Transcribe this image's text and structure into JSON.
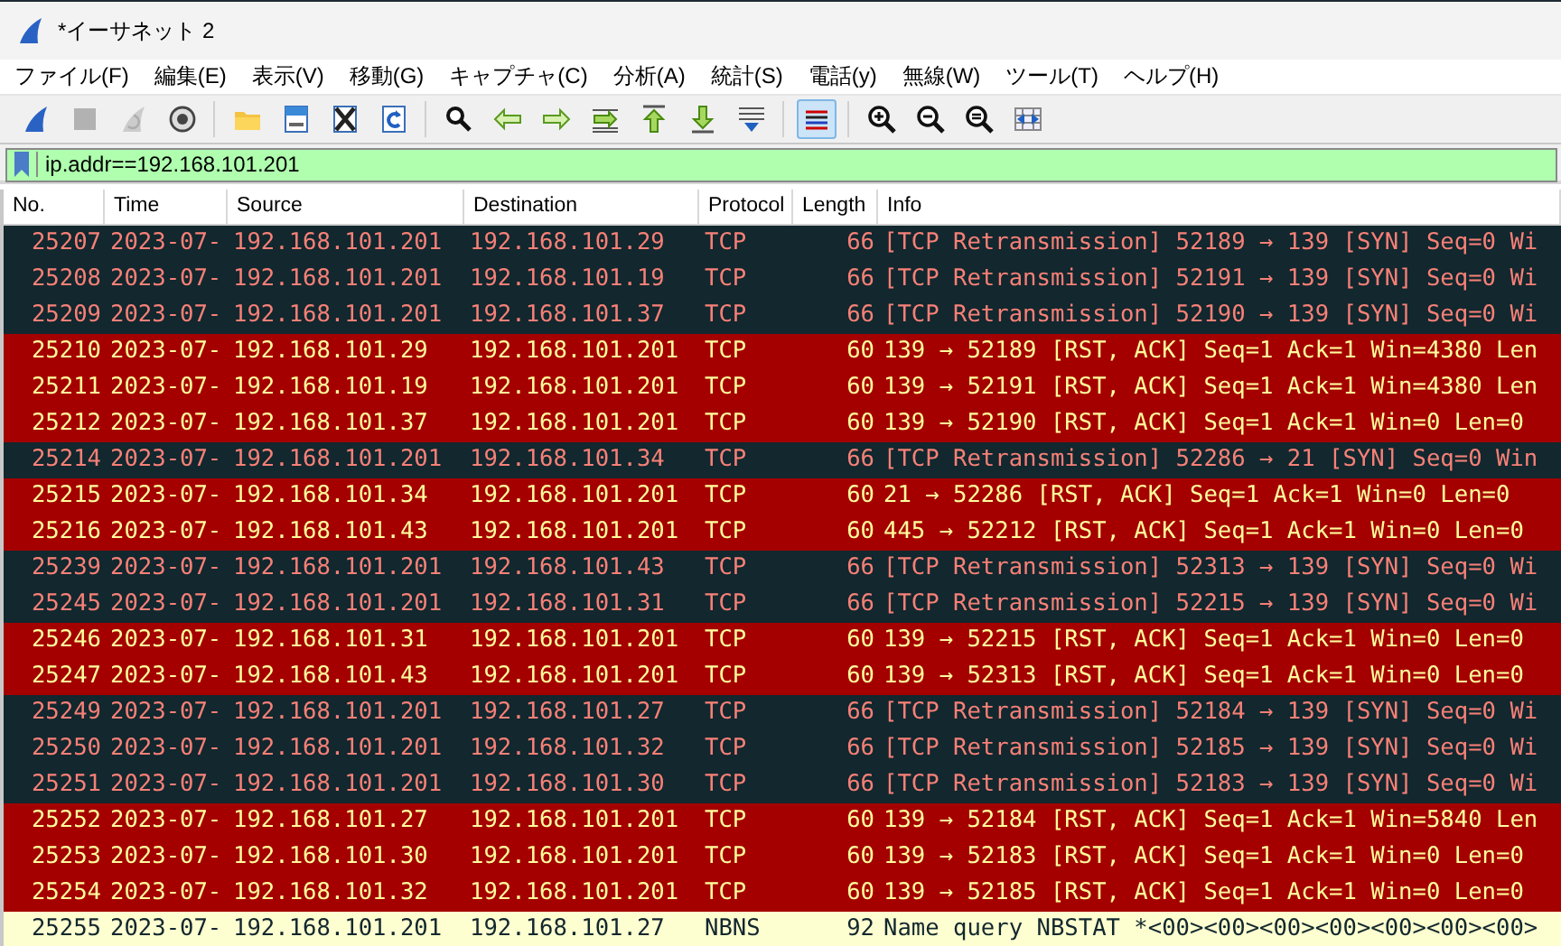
{
  "window": {
    "title": "*イーサネット 2"
  },
  "menu": [
    "ファイル(F)",
    "編集(E)",
    "表示(V)",
    "移動(G)",
    "キャプチャ(C)",
    "分析(A)",
    "統計(S)",
    "電話(y)",
    "無線(W)",
    "ツール(T)",
    "ヘルプ(H)"
  ],
  "toolbar": [
    [
      {
        "disabled": false,
        "selected": false
      },
      {
        "disabled": true,
        "selected": false
      },
      {
        "disabled": true,
        "selected": false
      },
      {
        "disabled": false,
        "selected": false
      }
    ],
    [
      {
        "disabled": false,
        "selected": false
      },
      {
        "disabled": false,
        "selected": false
      },
      {
        "disabled": false,
        "selected": false
      },
      {
        "disabled": false,
        "selected": false
      }
    ],
    [
      {
        "disabled": false,
        "selected": false
      },
      {
        "disabled": false,
        "selected": false
      },
      {
        "disabled": false,
        "selected": false
      },
      {
        "disabled": false,
        "selected": false
      },
      {
        "disabled": false,
        "selected": false
      },
      {
        "disabled": false,
        "selected": false
      },
      {
        "disabled": false,
        "selected": false
      }
    ],
    [
      {
        "disabled": false,
        "selected": true
      }
    ],
    [
      {
        "disabled": false,
        "selected": false
      },
      {
        "disabled": false,
        "selected": false
      },
      {
        "disabled": false,
        "selected": false
      },
      {
        "disabled": false,
        "selected": false
      }
    ]
  ],
  "filter": {
    "value": "ip.addr==192.168.101.201"
  },
  "table": {
    "columns": [
      "No.",
      "Time",
      "Source",
      "Destination",
      "Protocol",
      "Length",
      "Info"
    ],
    "rows": [
      {
        "kind": "retransmission",
        "cells": [
          "25207",
          "2023-07-",
          "192.168.101.201",
          "192.168.101.29",
          "TCP",
          "66",
          "[TCP Retransmission] 52189 → 139 [SYN] Seq=0 Wi"
        ]
      },
      {
        "kind": "retransmission",
        "cells": [
          "25208",
          "2023-07-",
          "192.168.101.201",
          "192.168.101.19",
          "TCP",
          "66",
          "[TCP Retransmission] 52191 → 139 [SYN] Seq=0 Wi"
        ]
      },
      {
        "kind": "retransmission",
        "cells": [
          "25209",
          "2023-07-",
          "192.168.101.201",
          "192.168.101.37",
          "TCP",
          "66",
          "[TCP Retransmission] 52190 → 139 [SYN] Seq=0 Wi"
        ]
      },
      {
        "kind": "reset",
        "cells": [
          "25210",
          "2023-07-",
          "192.168.101.29",
          "192.168.101.201",
          "TCP",
          "60",
          "139 → 52189 [RST, ACK] Seq=1 Ack=1 Win=4380 Len"
        ]
      },
      {
        "kind": "reset",
        "cells": [
          "25211",
          "2023-07-",
          "192.168.101.19",
          "192.168.101.201",
          "TCP",
          "60",
          "139 → 52191 [RST, ACK] Seq=1 Ack=1 Win=4380 Len"
        ]
      },
      {
        "kind": "reset",
        "cells": [
          "25212",
          "2023-07-",
          "192.168.101.37",
          "192.168.101.201",
          "TCP",
          "60",
          "139 → 52190 [RST, ACK] Seq=1 Ack=1 Win=0 Len=0"
        ]
      },
      {
        "kind": "retransmission",
        "cells": [
          "25214",
          "2023-07-",
          "192.168.101.201",
          "192.168.101.34",
          "TCP",
          "66",
          "[TCP Retransmission] 52286 → 21 [SYN] Seq=0 Win"
        ]
      },
      {
        "kind": "reset",
        "cells": [
          "25215",
          "2023-07-",
          "192.168.101.34",
          "192.168.101.201",
          "TCP",
          "60",
          "21 → 52286 [RST, ACK] Seq=1 Ack=1 Win=0 Len=0"
        ]
      },
      {
        "kind": "reset",
        "cells": [
          "25216",
          "2023-07-",
          "192.168.101.43",
          "192.168.101.201",
          "TCP",
          "60",
          "445 → 52212 [RST, ACK] Seq=1 Ack=1 Win=0 Len=0"
        ]
      },
      {
        "kind": "retransmission",
        "cells": [
          "25239",
          "2023-07-",
          "192.168.101.201",
          "192.168.101.43",
          "TCP",
          "66",
          "[TCP Retransmission] 52313 → 139 [SYN] Seq=0 Wi"
        ]
      },
      {
        "kind": "retransmission",
        "cells": [
          "25245",
          "2023-07-",
          "192.168.101.201",
          "192.168.101.31",
          "TCP",
          "66",
          "[TCP Retransmission] 52215 → 139 [SYN] Seq=0 Wi"
        ]
      },
      {
        "kind": "reset",
        "cells": [
          "25246",
          "2023-07-",
          "192.168.101.31",
          "192.168.101.201",
          "TCP",
          "60",
          "139 → 52215 [RST, ACK] Seq=1 Ack=1 Win=0 Len=0"
        ]
      },
      {
        "kind": "reset",
        "cells": [
          "25247",
          "2023-07-",
          "192.168.101.43",
          "192.168.101.201",
          "TCP",
          "60",
          "139 → 52313 [RST, ACK] Seq=1 Ack=1 Win=0 Len=0"
        ]
      },
      {
        "kind": "retransmission",
        "cells": [
          "25249",
          "2023-07-",
          "192.168.101.201",
          "192.168.101.27",
          "TCP",
          "66",
          "[TCP Retransmission] 52184 → 139 [SYN] Seq=0 Wi"
        ]
      },
      {
        "kind": "retransmission",
        "cells": [
          "25250",
          "2023-07-",
          "192.168.101.201",
          "192.168.101.32",
          "TCP",
          "66",
          "[TCP Retransmission] 52185 → 139 [SYN] Seq=0 Wi"
        ]
      },
      {
        "kind": "retransmission",
        "cells": [
          "25251",
          "2023-07-",
          "192.168.101.201",
          "192.168.101.30",
          "TCP",
          "66",
          "[TCP Retransmission] 52183 → 139 [SYN] Seq=0 Wi"
        ]
      },
      {
        "kind": "reset",
        "cells": [
          "25252",
          "2023-07-",
          "192.168.101.27",
          "192.168.101.201",
          "TCP",
          "60",
          "139 → 52184 [RST, ACK] Seq=1 Ack=1 Win=5840 Len"
        ]
      },
      {
        "kind": "reset",
        "cells": [
          "25253",
          "2023-07-",
          "192.168.101.30",
          "192.168.101.201",
          "TCP",
          "60",
          "139 → 52183 [RST, ACK] Seq=1 Ack=1 Win=0 Len=0"
        ]
      },
      {
        "kind": "reset",
        "cells": [
          "25254",
          "2023-07-",
          "192.168.101.32",
          "192.168.101.201",
          "TCP",
          "60",
          "139 → 52185 [RST, ACK] Seq=1 Ack=1 Win=0 Len=0"
        ]
      },
      {
        "kind": "nbns",
        "cells": [
          "25255",
          "2023-07-",
          "192.168.101.201",
          "192.168.101.27",
          "NBNS",
          "92",
          "Name query NBSTAT *<00><00><00><00><00><00><00>"
        ]
      }
    ]
  }
}
